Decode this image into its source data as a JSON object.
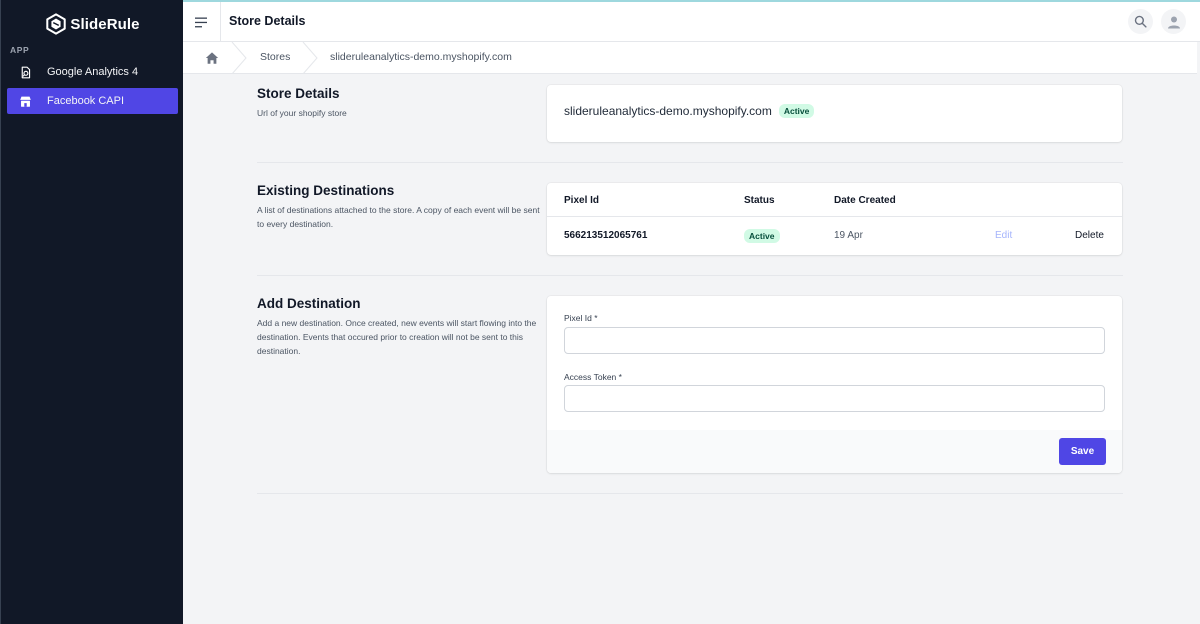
{
  "app": {
    "brand": "SlideRule",
    "accent_color": "#4f46e5"
  },
  "sidebar": {
    "section_label": "APP",
    "items": [
      {
        "label": "Google Analytics 4",
        "icon": "analytics-icon",
        "active": false
      },
      {
        "label": "Facebook CAPI",
        "icon": "store-icon",
        "active": true
      }
    ]
  },
  "header": {
    "title": "Store Details",
    "icons": [
      "menu-icon",
      "search-icon",
      "user-icon"
    ]
  },
  "breadcrumb": {
    "items": [
      "Stores",
      "slideruleanalytics-demo.myshopify.com"
    ]
  },
  "store_details": {
    "title": "Store Details",
    "description": "Url of your shopify store",
    "url": "slideruleanalytics-demo.myshopify.com",
    "status": "Active"
  },
  "existing_destinations": {
    "title": "Existing Destinations",
    "description": "A list of destinations attached to the store. A copy of each event will be sent to every destination.",
    "columns": [
      "Pixel Id",
      "Status",
      "Date Created"
    ],
    "rows": [
      {
        "pixel_id": "566213512065761",
        "status": "Active",
        "date_created": "19 Apr",
        "edit_label": "Edit",
        "delete_label": "Delete"
      }
    ]
  },
  "add_destination": {
    "title": "Add Destination",
    "description": "Add a new destination. Once created, new events will start flowing into the destination. Events that occured prior to creation will not be sent to this destination.",
    "pixel_id_label": "Pixel Id",
    "access_token_label": "Access Token",
    "required_mark": "*",
    "pixel_id_value": "",
    "access_token_value": "",
    "save_label": "Save"
  }
}
